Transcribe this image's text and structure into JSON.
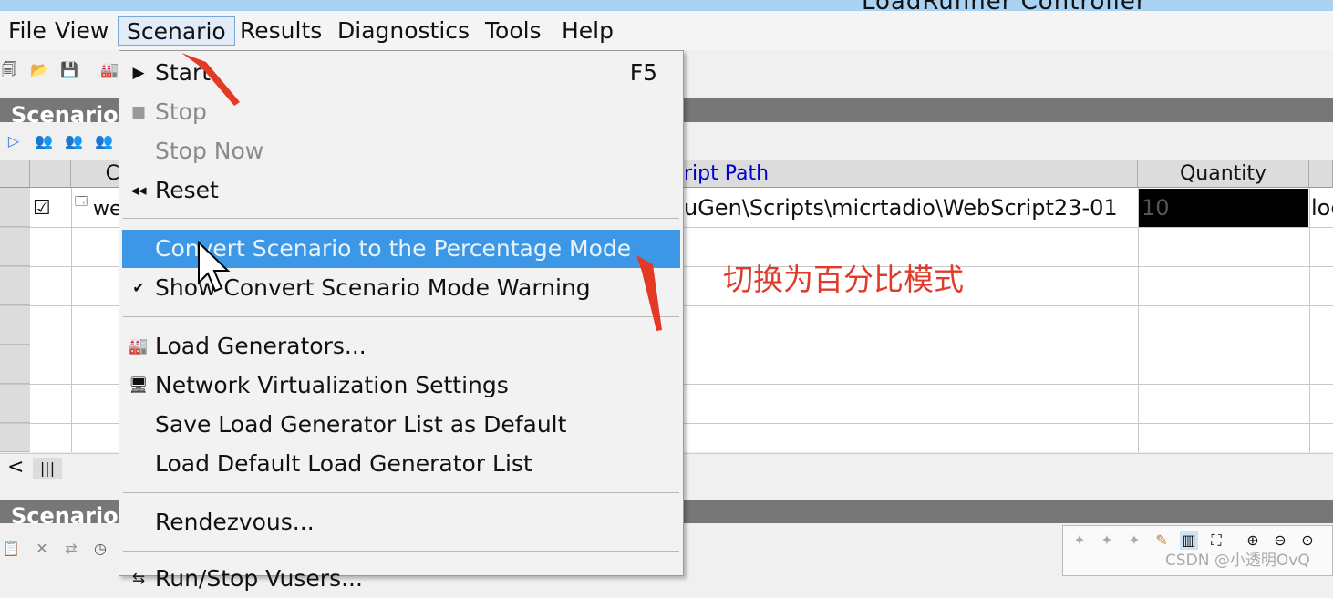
{
  "window": {
    "title_fragment": "LoadRunner Controller"
  },
  "menubar": {
    "items": [
      "File",
      "View",
      "Scenario",
      "Results",
      "Diagnostics",
      "Tools",
      "Help"
    ],
    "active": "Scenario"
  },
  "sections": {
    "scenario_groups": "Scenario",
    "scenario_status": "Scenario"
  },
  "grid": {
    "col_c": "C",
    "col_script_path": "ript Path",
    "col_quantity": "Quantity",
    "row": {
      "checked": "☑",
      "name": "we",
      "script_path": "uGen\\Scripts\\micrtadio\\WebScript23-01",
      "quantity": "10",
      "next": "loc"
    }
  },
  "scenario_menu": {
    "start": {
      "label": "Start",
      "shortcut": "F5",
      "icon": "play-icon"
    },
    "stop": {
      "label": "Stop",
      "icon": "stop-icon",
      "disabled": true
    },
    "stop_now": {
      "label": "Stop Now",
      "disabled": true
    },
    "reset": {
      "label": "Reset",
      "icon": "rewind-icon"
    },
    "convert": {
      "label": "Convert Scenario to the Percentage Mode",
      "highlighted": true
    },
    "show_warning": {
      "label": "Show Convert Scenario Mode Warning",
      "checked": true
    },
    "load_generators": {
      "label": "Load Generators...",
      "icon": "load-generator-icon"
    },
    "network_virtualization": {
      "label": "Network Virtualization Settings",
      "icon": "network-icon"
    },
    "save_lg_list": {
      "label": "Save Load Generator List as Default"
    },
    "load_default_lg_list": {
      "label": "Load Default Load Generator List"
    },
    "rendezvous": {
      "label": "Rendezvous..."
    },
    "run_stop_vusers": {
      "label": "Run/Stop Vusers..."
    }
  },
  "annotation": {
    "note": "切换为百分比模式",
    "color": "#e03a2a"
  },
  "watermark": "CSDN @小透明OvQ",
  "colors": {
    "highlight": "#3c97e7",
    "section_header": "#777777",
    "titlebar": "#a9d2f2"
  }
}
